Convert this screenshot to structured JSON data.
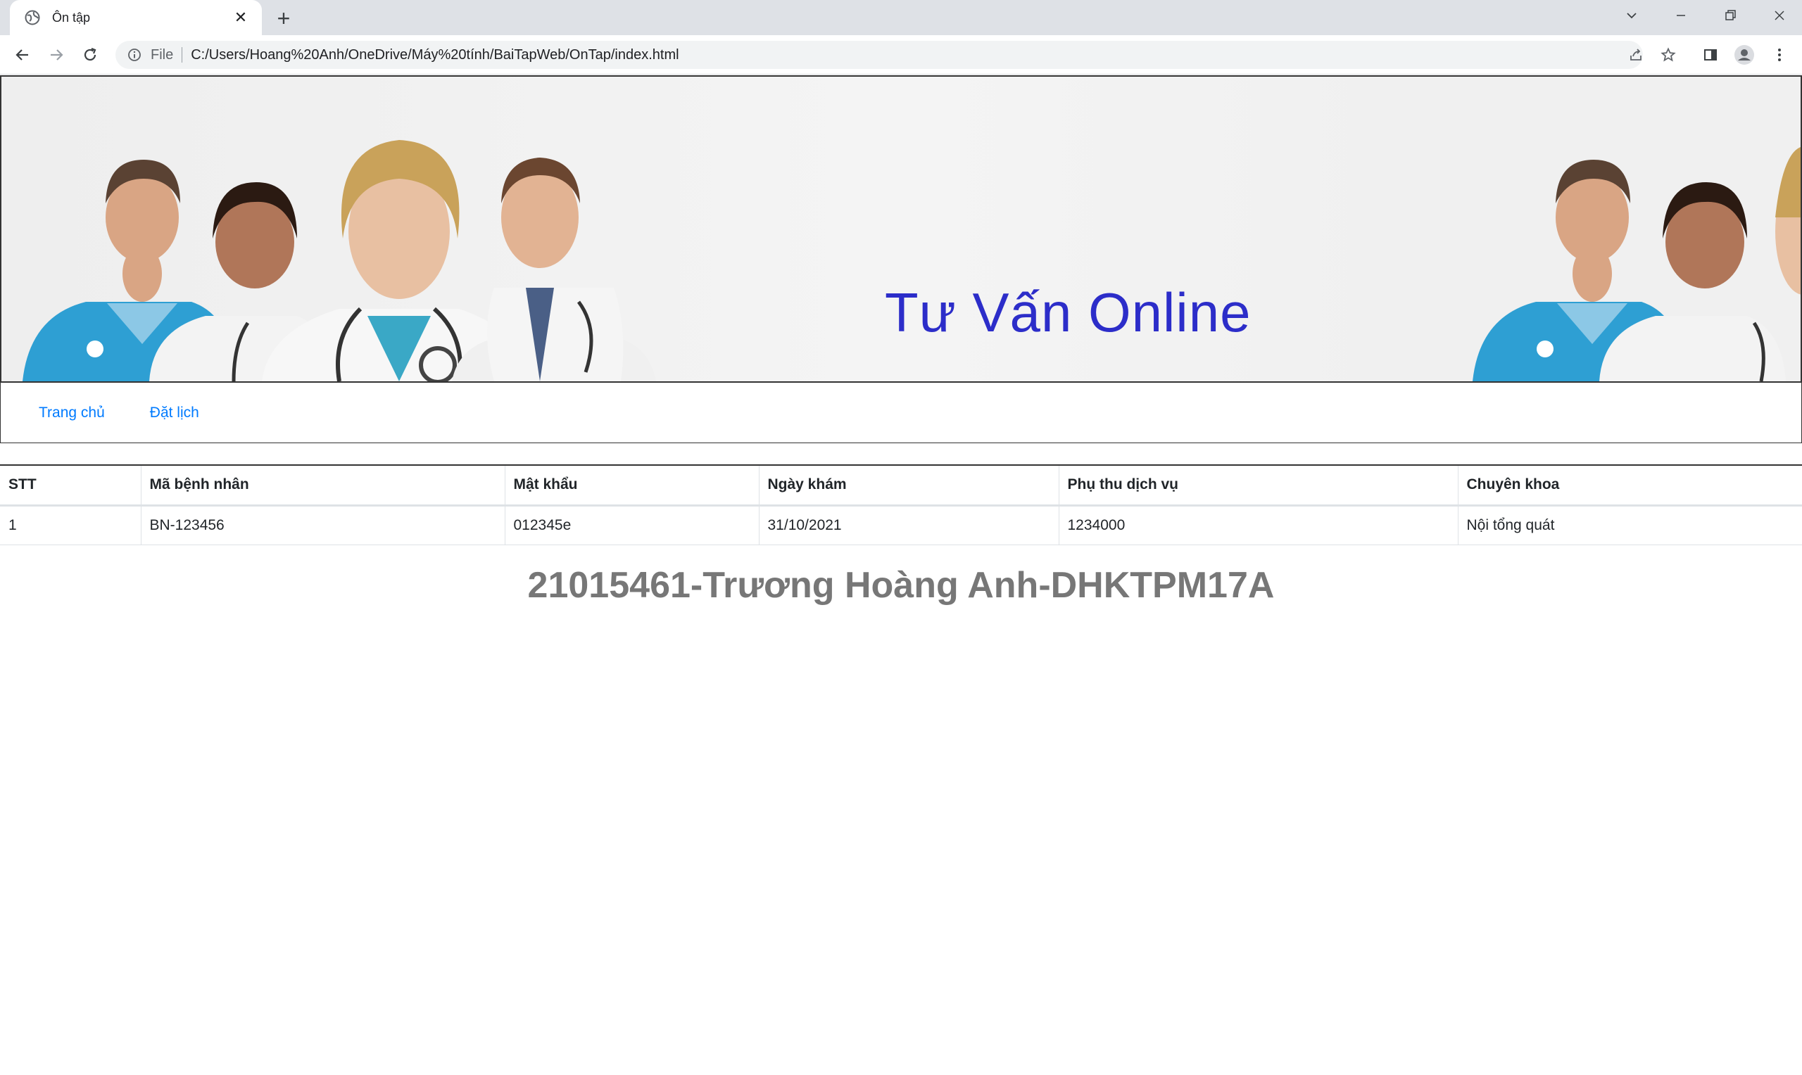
{
  "browser": {
    "tab_title": "Ôn tập",
    "url_scheme": "File",
    "url": "C:/Users/Hoang%20Anh/OneDrive/Máy%20tính/BaiTapWeb/OnTap/index.html"
  },
  "banner": {
    "title": "Tư Vấn Online"
  },
  "nav": {
    "items": [
      {
        "label": "Trang chủ"
      },
      {
        "label": "Đặt lịch"
      }
    ]
  },
  "table": {
    "headers": [
      "STT",
      "Mã bệnh nhân",
      "Mật khẩu",
      "Ngày khám",
      "Phụ thu dịch vụ",
      "Chuyên khoa"
    ],
    "rows": [
      [
        "1",
        "BN-123456",
        "012345e",
        "31/10/2021",
        "1234000",
        "Nội tổng quát"
      ]
    ]
  },
  "footer": {
    "heading": "21015461-Trương Hoàng Anh-DHKTPM17A"
  }
}
